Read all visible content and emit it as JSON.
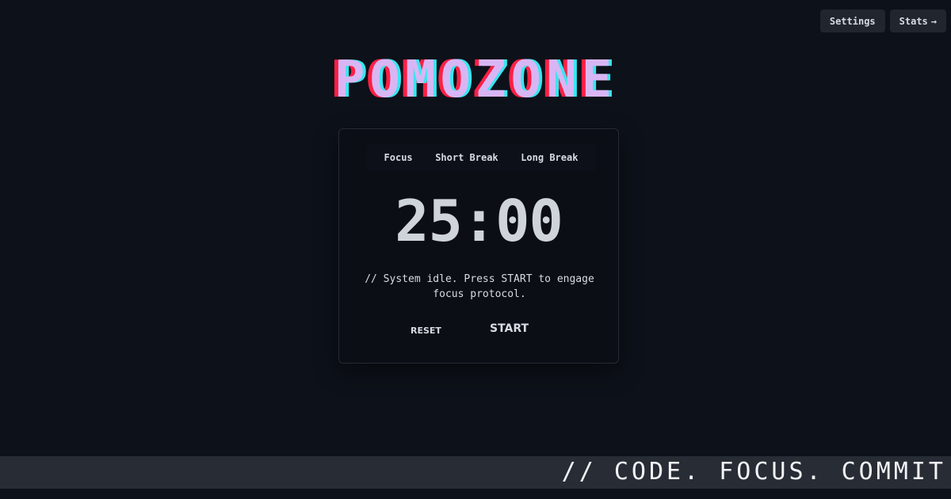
{
  "header": {
    "settings_label": "Settings",
    "stats_label": "Stats",
    "stats_arrow": "→"
  },
  "logo": {
    "text": "POMOZONE"
  },
  "timer_card": {
    "tabs": [
      {
        "label": "Focus"
      },
      {
        "label": "Short Break"
      },
      {
        "label": "Long Break"
      }
    ],
    "time": "25:00",
    "status_line1": "// System idle. Press START to engage",
    "status_line2": "focus protocol.",
    "reset_label": "RESET",
    "start_label": "START"
  },
  "banner": {
    "text": "// CODE. FOCUS. COMMIT"
  },
  "colors": {
    "background": "#0d1119",
    "card": "#0b0e14",
    "logo_main": "#d8b6f4",
    "logo_red": "#ff1f44",
    "logo_cyan": "#38e6f0",
    "banner": "#282c35"
  }
}
